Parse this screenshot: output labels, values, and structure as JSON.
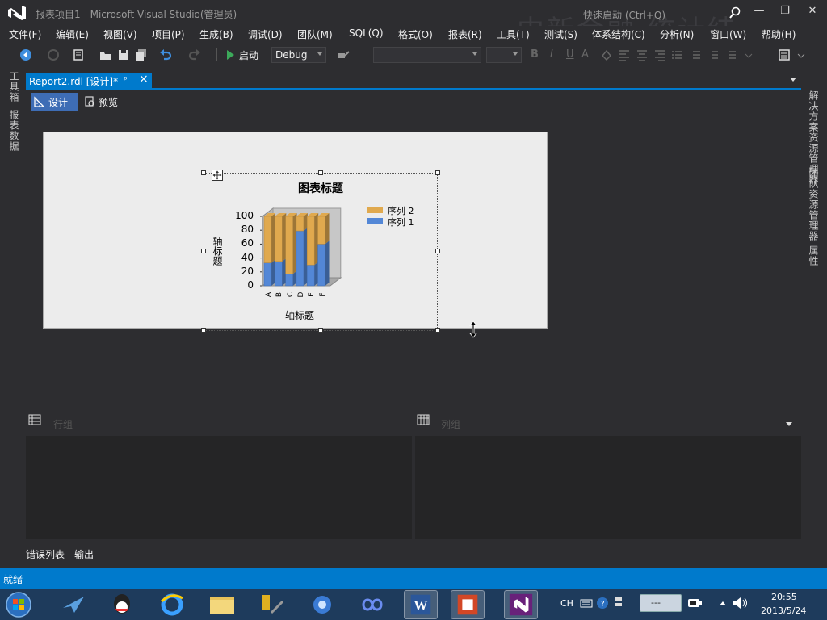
{
  "window": {
    "title": "报表项目1 - Microsoft Visual Studio(管理员)",
    "watermark": "中新金融 统计结",
    "quick_launch": "快速启动 (Ctrl+Q)",
    "controls": {
      "minimize": "—",
      "restore": "❐",
      "close": "✕"
    }
  },
  "menu": [
    "文件(F)",
    "编辑(E)",
    "视图(V)",
    "项目(P)",
    "生成(B)",
    "调试(D)",
    "团队(M)",
    "SQL(Q)",
    "格式(O)",
    "报表(R)",
    "工具(T)",
    "测试(S)",
    "体系结构(C)",
    "分析(N)",
    "窗口(W)",
    "帮助(H)"
  ],
  "toolbar": {
    "start_label": "启动",
    "config_value": "Debug",
    "font_value": "",
    "size_value": "",
    "format_letters": [
      "B",
      "I",
      "U",
      "A"
    ]
  },
  "left_panel": {
    "toolbox": "工具箱",
    "report_data": "报表数据"
  },
  "right_panel": {
    "solution_explorer": "解决方案资源管理器",
    "team_explorer": "团队资源管理器",
    "properties": "属性"
  },
  "document": {
    "tab_title": "Report2.rdl [设计]*",
    "pin_glyph": "ᵖ",
    "close_glyph": "×",
    "design_label": "设计",
    "preview_label": "预览"
  },
  "grouping": {
    "row_groups": "行组",
    "column_groups": "列组"
  },
  "bottom_tabs": {
    "error_list": "错误列表",
    "output": "输出"
  },
  "status": {
    "text": "就绪"
  },
  "taskbar": {
    "apps": [
      "start-icon",
      "feiq-icon",
      "qq-icon",
      "ie-icon",
      "explorer-icon",
      "tools-icon",
      "network-icon",
      "infinity-icon",
      "word-icon",
      "powerpoint-icon",
      "visual-studio-icon"
    ],
    "tray": {
      "lang": "CH",
      "ime": "---",
      "time": "20:55",
      "date": "2013/5/24"
    }
  },
  "colors": {
    "accent": "#007acc",
    "series1": "#5387d6",
    "series2": "#e0a94e",
    "report_bg": "#ececec",
    "chart_wall": "#c7c7c7"
  },
  "chart_data": {
    "type": "bar",
    "stacked": true,
    "title": "图表标题",
    "xlabel": "轴标题",
    "ylabel": "轴标题",
    "categories": [
      "A",
      "B",
      "C",
      "D",
      "E",
      "F"
    ],
    "ylim": [
      0,
      100
    ],
    "yticks": [
      0,
      20,
      40,
      60,
      80,
      100
    ],
    "series": [
      {
        "name": "序列 1",
        "values": [
          33,
          35,
          17,
          79,
          30,
          60
        ]
      },
      {
        "name": "序列 2",
        "values": [
          67,
          65,
          83,
          21,
          70,
          40
        ]
      }
    ],
    "legend_order": [
      "序列 2",
      "序列 1"
    ],
    "legend": "right"
  }
}
